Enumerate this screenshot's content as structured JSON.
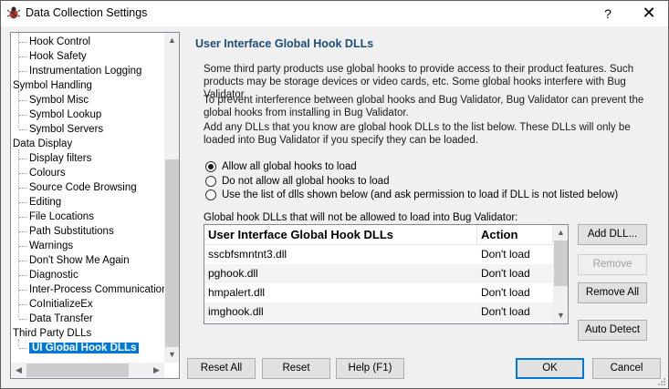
{
  "window": {
    "title": "Data Collection Settings",
    "help_label": "?",
    "close_label": "✕"
  },
  "tree": {
    "items": [
      {
        "label": "Hook Control",
        "level": 1
      },
      {
        "label": "Hook Safety",
        "level": 1
      },
      {
        "label": "Instrumentation Logging",
        "level": 1
      },
      {
        "label": "Symbol Handling",
        "level": 0
      },
      {
        "label": "Symbol Misc",
        "level": 1
      },
      {
        "label": "Symbol Lookup",
        "level": 1
      },
      {
        "label": "Symbol Servers",
        "level": 1
      },
      {
        "label": "Data Display",
        "level": 0
      },
      {
        "label": "Display filters",
        "level": 1
      },
      {
        "label": "Colours",
        "level": 1
      },
      {
        "label": "Source Code Browsing",
        "level": 1
      },
      {
        "label": "Editing",
        "level": 1
      },
      {
        "label": "File Locations",
        "level": 1
      },
      {
        "label": "Path Substitutions",
        "level": 1
      },
      {
        "label": "Warnings",
        "level": 1
      },
      {
        "label": "Don't Show Me Again",
        "level": 1
      },
      {
        "label": "Diagnostic",
        "level": 1
      },
      {
        "label": "Inter-Process Communication",
        "level": 1
      },
      {
        "label": "CoInitializeEx",
        "level": 1
      },
      {
        "label": "Data Transfer",
        "level": 1
      },
      {
        "label": "Third Party DLLs",
        "level": 0
      },
      {
        "label": "UI Global Hook DLLs",
        "level": 1,
        "selected": true
      }
    ]
  },
  "panel": {
    "title": "User Interface Global Hook DLLs",
    "para1": "Some third party products use global hooks to provide access to their product features. Such products may be storage devices or video cards, etc. Some global hooks interfere with Bug Validator.",
    "para2": "To prevent interference between global hooks and Bug Validator, Bug Validator can prevent the global hooks from installing in Bug Validator.",
    "para3": "Add any DLLs that you know are global hook DLLs to the list below. These DLLs will only be loaded into Bug Validator if you specify they can be loaded.",
    "radios": [
      {
        "label": "Allow all global hooks to load",
        "checked": true
      },
      {
        "label": "Do not allow all global hooks to load",
        "checked": false
      },
      {
        "label": "Use the list of dlls shown below (and ask permission to load if DLL is not listed below)",
        "checked": false
      }
    ],
    "list_label": "Global hook DLLs that will not be allowed to load into Bug Validator:",
    "list": {
      "columns": [
        "User Interface Global Hook DLLs",
        "Action"
      ],
      "rows": [
        [
          "sscbfsmntnt3.dll",
          "Don't load"
        ],
        [
          "pghook.dll",
          "Don't load"
        ],
        [
          "hmpalert.dll",
          "Don't load"
        ],
        [
          "imghook.dll",
          "Don't load"
        ]
      ]
    },
    "side_buttons": {
      "add": "Add DLL...",
      "remove": "Remove",
      "remove_all": "Remove All",
      "auto_detect": "Auto Detect"
    }
  },
  "footer": {
    "reset_all": "Reset All",
    "reset": "Reset",
    "help": "Help (F1)",
    "ok": "OK",
    "cancel": "Cancel"
  }
}
